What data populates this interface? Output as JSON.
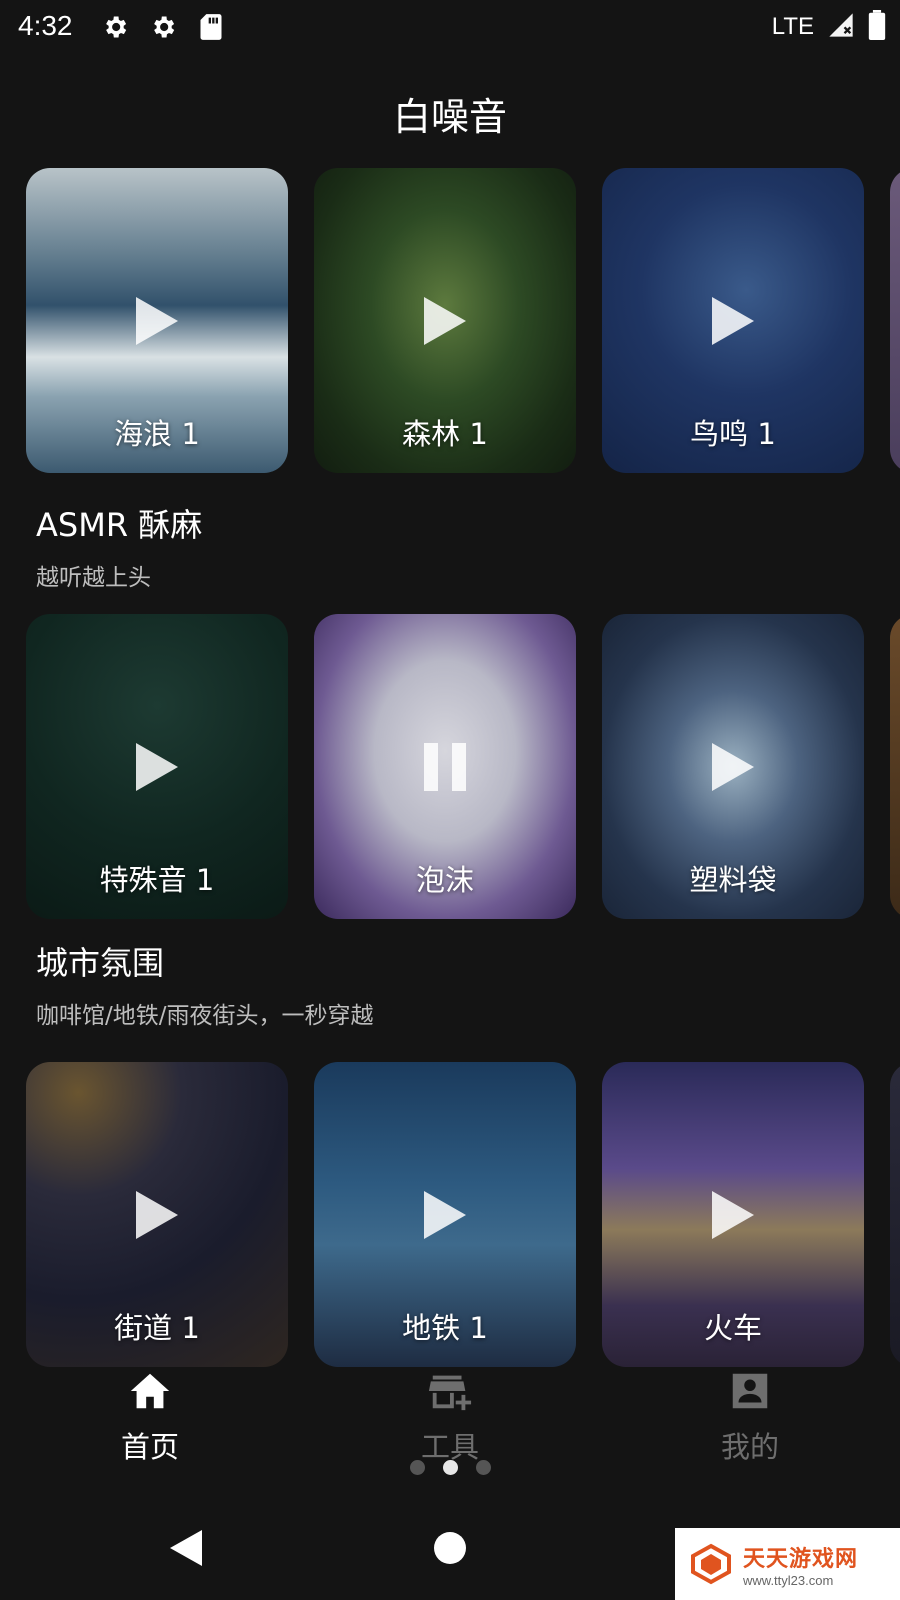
{
  "status": {
    "time": "4:32",
    "network": "LTE"
  },
  "title": "白噪音",
  "sections": [
    {
      "title": "",
      "subtitle": "",
      "cards": [
        {
          "label": "海浪 1",
          "state": "play"
        },
        {
          "label": "森林 1",
          "state": "play"
        },
        {
          "label": "鸟鸣 1",
          "state": "play"
        }
      ]
    },
    {
      "title": "ASMR 酥麻",
      "subtitle": "越听越上头",
      "cards": [
        {
          "label": "特殊音 1",
          "state": "play"
        },
        {
          "label": "泡沫",
          "state": "pause"
        },
        {
          "label": "塑料袋",
          "state": "play"
        }
      ]
    },
    {
      "title": "城市氛围",
      "subtitle": "咖啡馆/地铁/雨夜街头，一秒穿越",
      "cards": [
        {
          "label": "街道 1",
          "state": "play"
        },
        {
          "label": "地铁 1",
          "state": "play"
        },
        {
          "label": "火车",
          "state": "play"
        }
      ]
    }
  ],
  "nav": {
    "items": [
      {
        "label": "首页",
        "icon": "home-icon",
        "active": true
      },
      {
        "label": "工具",
        "icon": "store-add-icon",
        "active": false
      },
      {
        "label": "我的",
        "icon": "account-box-icon",
        "active": false
      }
    ],
    "pager_dots": 3,
    "pager_active": 1
  },
  "watermark": {
    "title": "天天游戏网",
    "url": "www.ttyl23.com"
  },
  "colors": {
    "background": "#141414",
    "text": "#ffffff",
    "muted": "#bdbdbd",
    "watermark": "#e0541f"
  }
}
